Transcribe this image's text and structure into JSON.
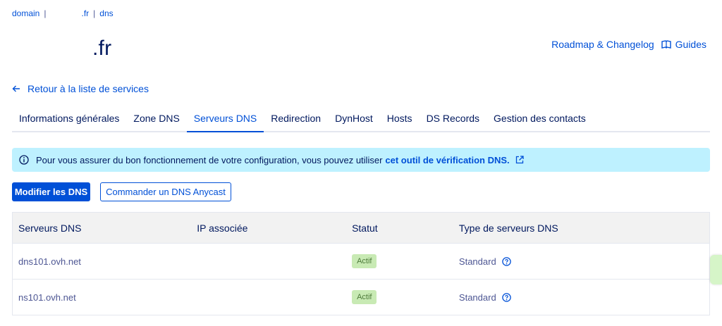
{
  "breadcrumb": {
    "domain": "domain",
    "separator": "|",
    "tld": ".fr",
    "section": "dns"
  },
  "page": {
    "title": ".fr"
  },
  "top_links": {
    "roadmap": "Roadmap & Changelog",
    "guides": "Guides"
  },
  "back_link": "Retour à la liste de services",
  "tabs": [
    {
      "label": "Informations générales"
    },
    {
      "label": "Zone DNS"
    },
    {
      "label": "Serveurs DNS",
      "active": true
    },
    {
      "label": "Redirection"
    },
    {
      "label": "DynHost"
    },
    {
      "label": "Hosts"
    },
    {
      "label": "DS Records"
    },
    {
      "label": "Gestion des contacts"
    }
  ],
  "info_banner": {
    "text": "Pour vous assurer du bon fonctionnement de votre configuration, vous pouvez utiliser",
    "link": "cet outil de vérification DNS."
  },
  "buttons": {
    "modify_dns": "Modifier les DNS",
    "order_anycast": "Commander un DNS Anycast"
  },
  "table": {
    "headers": [
      "Serveurs DNS",
      "IP associée",
      "Statut",
      "Type de serveurs DNS"
    ],
    "rows": [
      {
        "server": "dns101.ovh.net",
        "ip": "",
        "status": "Actif",
        "type": "Standard"
      },
      {
        "server": "ns101.ovh.net",
        "ip": "",
        "status": "Actif",
        "type": "Standard"
      }
    ]
  },
  "colors": {
    "accent": "#0050d7",
    "title": "#00185e",
    "banner": "#bef1ff",
    "badge": "#c8eab4"
  }
}
